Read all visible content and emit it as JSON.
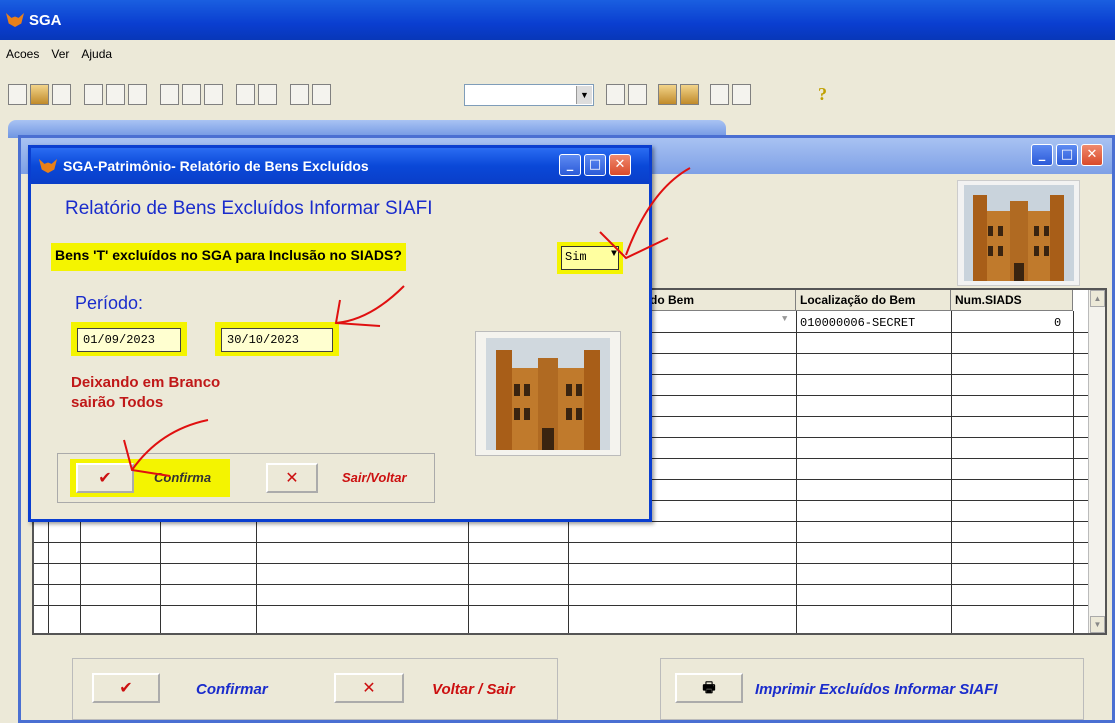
{
  "app": {
    "title": "SGA"
  },
  "menu": {
    "items": [
      "Acoes",
      "Ver",
      "Ajuda"
    ]
  },
  "dialog": {
    "title": "SGA-Patrimônio- Relatório de Bens Excluídos",
    "heading": "Relatório de Bens Excluídos Informar SIAFI",
    "question": "Bens 'T' excluídos no SGA para Inclusão no SIADS?",
    "select_value": "Sim",
    "periodo_label": "Período:",
    "date_start": "01/09/2023",
    "date_end": "30/10/2023",
    "note_line1": "Deixando em Branco",
    "note_line2": "sairão Todos",
    "confirm_label": "Confirma",
    "exit_label": "Sair/Voltar"
  },
  "grid": {
    "headers": [
      "do Bem",
      "Localização do Bem",
      "Num.SIADS"
    ],
    "row1": {
      "location": "010000006-SECRET",
      "num_siads": "0"
    }
  },
  "bottom": {
    "confirm_label": "Confirmar",
    "exit_label": "Voltar / Sair",
    "print_label": "Imprimir Excluídos Informar SIAFI"
  }
}
